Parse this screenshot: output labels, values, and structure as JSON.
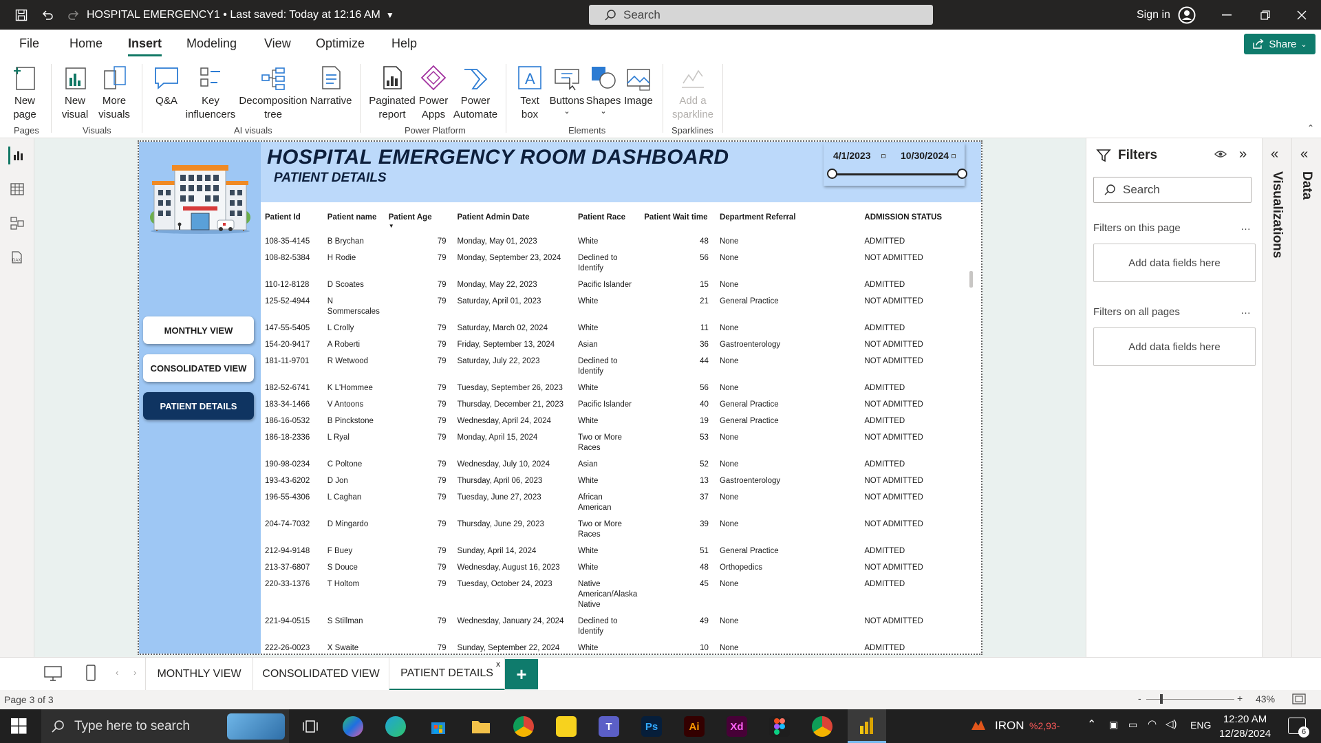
{
  "titlebar": {
    "document_title": "HOSPITAL EMERGENCY1 • Last saved: Today at 12:16 AM",
    "search_placeholder": "Search",
    "sign_in": "Sign in"
  },
  "menu": {
    "tabs": [
      "File",
      "Home",
      "Insert",
      "Modeling",
      "View",
      "Optimize",
      "Help"
    ],
    "active": "Insert",
    "share_label": "Share"
  },
  "ribbon": {
    "new_page": "New\npage",
    "new_visual": "New\nvisual",
    "more_visuals": "More\nvisuals",
    "qa": "Q&A",
    "key_influencers": "Key\ninfluencers",
    "decomposition_tree": "Decomposition\ntree",
    "narrative": "Narrative",
    "paginated_report": "Paginated\nreport",
    "power_apps": "Power\nApps",
    "power_automate": "Power\nAutomate",
    "text_box": "Text\nbox",
    "buttons": "Buttons",
    "shapes": "Shapes",
    "image": "Image",
    "add_sparkline": "Add a\nsparkline",
    "groups": {
      "pages": "Pages",
      "visuals": "Visuals",
      "ai_visuals": "AI visuals",
      "power_platform": "Power Platform",
      "elements": "Elements",
      "sparklines": "Sparklines"
    }
  },
  "report": {
    "title": "HOSPITAL EMERGENCY  ROOM DASHBOARD",
    "subtitle": "PATIENT DETAILS",
    "date_start": "4/1/2023",
    "date_end": "10/30/2024",
    "nav_buttons": [
      "MONTHLY VIEW",
      "CONSOLIDATED VIEW",
      "PATIENT DETAILS"
    ],
    "active_nav": "PATIENT DETAILS"
  },
  "table": {
    "columns": [
      "Patient Id",
      "Patient name",
      "Patient Age",
      "Patient Admin Date",
      "Patient Race",
      "Patient Wait time",
      "Department Referral",
      "ADMISSION STATUS"
    ],
    "rows": [
      [
        "108-35-4145",
        "B Brychan",
        "79",
        "Monday, May 01, 2023",
        "White",
        "48",
        "None",
        "ADMITTED"
      ],
      [
        "108-82-5384",
        "H Rodie",
        "79",
        "Monday, September 23, 2024",
        "Declined to Identify",
        "56",
        "None",
        "NOT ADMITTED"
      ],
      [
        "110-12-8128",
        "D Scoates",
        "79",
        "Monday, May 22, 2023",
        "Pacific Islander",
        "15",
        "None",
        "ADMITTED"
      ],
      [
        "125-52-4944",
        "N Sommerscales",
        "79",
        "Saturday, April 01, 2023",
        "White",
        "21",
        "General Practice",
        "NOT ADMITTED"
      ],
      [
        "147-55-5405",
        "L Crolly",
        "79",
        "Saturday, March 02, 2024",
        "White",
        "11",
        "None",
        "ADMITTED"
      ],
      [
        "154-20-9417",
        "A Roberti",
        "79",
        "Friday, September 13, 2024",
        "Asian",
        "36",
        "Gastroenterology",
        "NOT ADMITTED"
      ],
      [
        "181-11-9701",
        "R Wetwood",
        "79",
        "Saturday, July 22, 2023",
        "Declined to Identify",
        "44",
        "None",
        "NOT ADMITTED"
      ],
      [
        "182-52-6741",
        "K L'Hommee",
        "79",
        "Tuesday, September 26, 2023",
        "White",
        "56",
        "None",
        "ADMITTED"
      ],
      [
        "183-34-1466",
        "V Antoons",
        "79",
        "Thursday, December 21, 2023",
        "Pacific Islander",
        "40",
        "General Practice",
        "NOT ADMITTED"
      ],
      [
        "186-16-0532",
        "B Pinckstone",
        "79",
        "Wednesday, April 24, 2024",
        "White",
        "19",
        "General Practice",
        "ADMITTED"
      ],
      [
        "186-18-2336",
        "L Ryal",
        "79",
        "Monday, April 15, 2024",
        "Two or More Races",
        "53",
        "None",
        "NOT ADMITTED"
      ],
      [
        "190-98-0234",
        "C Poltone",
        "79",
        "Wednesday, July 10, 2024",
        "Asian",
        "52",
        "None",
        "ADMITTED"
      ],
      [
        "193-43-6202",
        "D Jon",
        "79",
        "Thursday, April 06, 2023",
        "White",
        "13",
        "Gastroenterology",
        "NOT ADMITTED"
      ],
      [
        "196-55-4306",
        "L Caghan",
        "79",
        "Tuesday, June 27, 2023",
        "African American",
        "37",
        "None",
        "NOT ADMITTED"
      ],
      [
        "204-74-7032",
        "D Mingardo",
        "79",
        "Thursday, June 29, 2023",
        "Two or More Races",
        "39",
        "None",
        "NOT ADMITTED"
      ],
      [
        "212-94-9148",
        "F Buey",
        "79",
        "Sunday, April 14, 2024",
        "White",
        "51",
        "General Practice",
        "ADMITTED"
      ],
      [
        "213-37-6807",
        "S Douce",
        "79",
        "Wednesday, August 16, 2023",
        "White",
        "48",
        "Orthopedics",
        "NOT ADMITTED"
      ],
      [
        "220-33-1376",
        "T Holtom",
        "79",
        "Tuesday, October 24, 2023",
        "Native American/Alaska Native",
        "45",
        "None",
        "ADMITTED"
      ],
      [
        "221-94-0515",
        "S Stillman",
        "79",
        "Wednesday, January 24, 2024",
        "Declined to Identify",
        "49",
        "None",
        "NOT ADMITTED"
      ],
      [
        "222-26-0023",
        "X Swaite",
        "79",
        "Sunday, September 22, 2024",
        "White",
        "10",
        "None",
        "ADMITTED"
      ]
    ]
  },
  "filters": {
    "title": "Filters",
    "search_placeholder": "Search",
    "on_this_page": "Filters on this page",
    "on_all_pages": "Filters on all pages",
    "add_fields": "Add data fields here"
  },
  "side_panes": {
    "visualizations": "Visualizations",
    "data": "Data"
  },
  "page_tabs": {
    "tabs": [
      "MONTHLY VIEW",
      "CONSOLIDATED VIEW",
      "PATIENT DETAILS"
    ],
    "active": "PATIENT DETAILS",
    "close": "x",
    "add": "+"
  },
  "status": {
    "page": "Page 3 of 3",
    "zoom": "43%",
    "zoom_minus": "-",
    "zoom_plus": "+"
  },
  "taskbar": {
    "search_placeholder": "Type here to search",
    "weather_label": "IRON",
    "weather_value": "%2,93-",
    "language": "ENG",
    "time": "12:20 AM",
    "date": "12/28/2024",
    "notifications": "6"
  },
  "colors": {
    "accent": "#117865",
    "share": "#0f7b6c",
    "side_panel": "#9ec7f4",
    "header_band": "#bcd9fa",
    "nav_active": "#0f3461"
  }
}
